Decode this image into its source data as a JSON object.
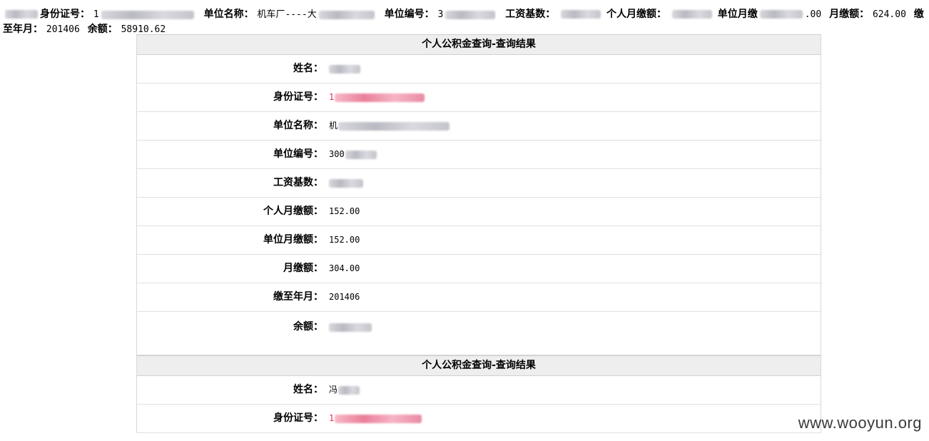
{
  "top_line": {
    "label_idcard": "身份证号：",
    "val_idcard_prefix": "1",
    "label_unitname": "单位名称：",
    "val_unitname_prefix": "机车厂----大",
    "label_unitno": "单位编号：",
    "val_unitno_prefix": "3",
    "label_wagebase": "工资基数：",
    "label_personal": "个人月缴额：",
    "label_unitmonthly": "单位月缴",
    "val_unitmonthly_suffix": ".00",
    "label_monthly": "月缴额：",
    "val_monthly": "624.00",
    "label_paidto": "缴至年月：",
    "val_paidto": "201406",
    "label_balance": "余额：",
    "val_balance": "58910.62"
  },
  "records": [
    {
      "title": "个人公积金查询-查询结果",
      "rows": [
        {
          "key": "姓名：",
          "value": ""
        },
        {
          "key": "身份证号：",
          "value": "1"
        },
        {
          "key": "单位名称：",
          "value": "机"
        },
        {
          "key": "单位编号：",
          "value": "300"
        },
        {
          "key": "工资基数：",
          "value": ""
        },
        {
          "key": "个人月缴额：",
          "value": "152.00"
        },
        {
          "key": "单位月缴额：",
          "value": "152.00"
        },
        {
          "key": "月缴额：",
          "value": "304.00"
        },
        {
          "key": "缴至年月：",
          "value": "201406"
        },
        {
          "key": "余额：",
          "value": ""
        }
      ]
    },
    {
      "title": "个人公积金查询-查询结果",
      "rows": [
        {
          "key": "姓名：",
          "value": "冯"
        },
        {
          "key": "身份证号：",
          "value": "1"
        }
      ]
    }
  ],
  "watermark": "www.wooyun.org",
  "colors": {
    "header_bg": "#eeeeee",
    "highlight_red": "#e02b58"
  }
}
